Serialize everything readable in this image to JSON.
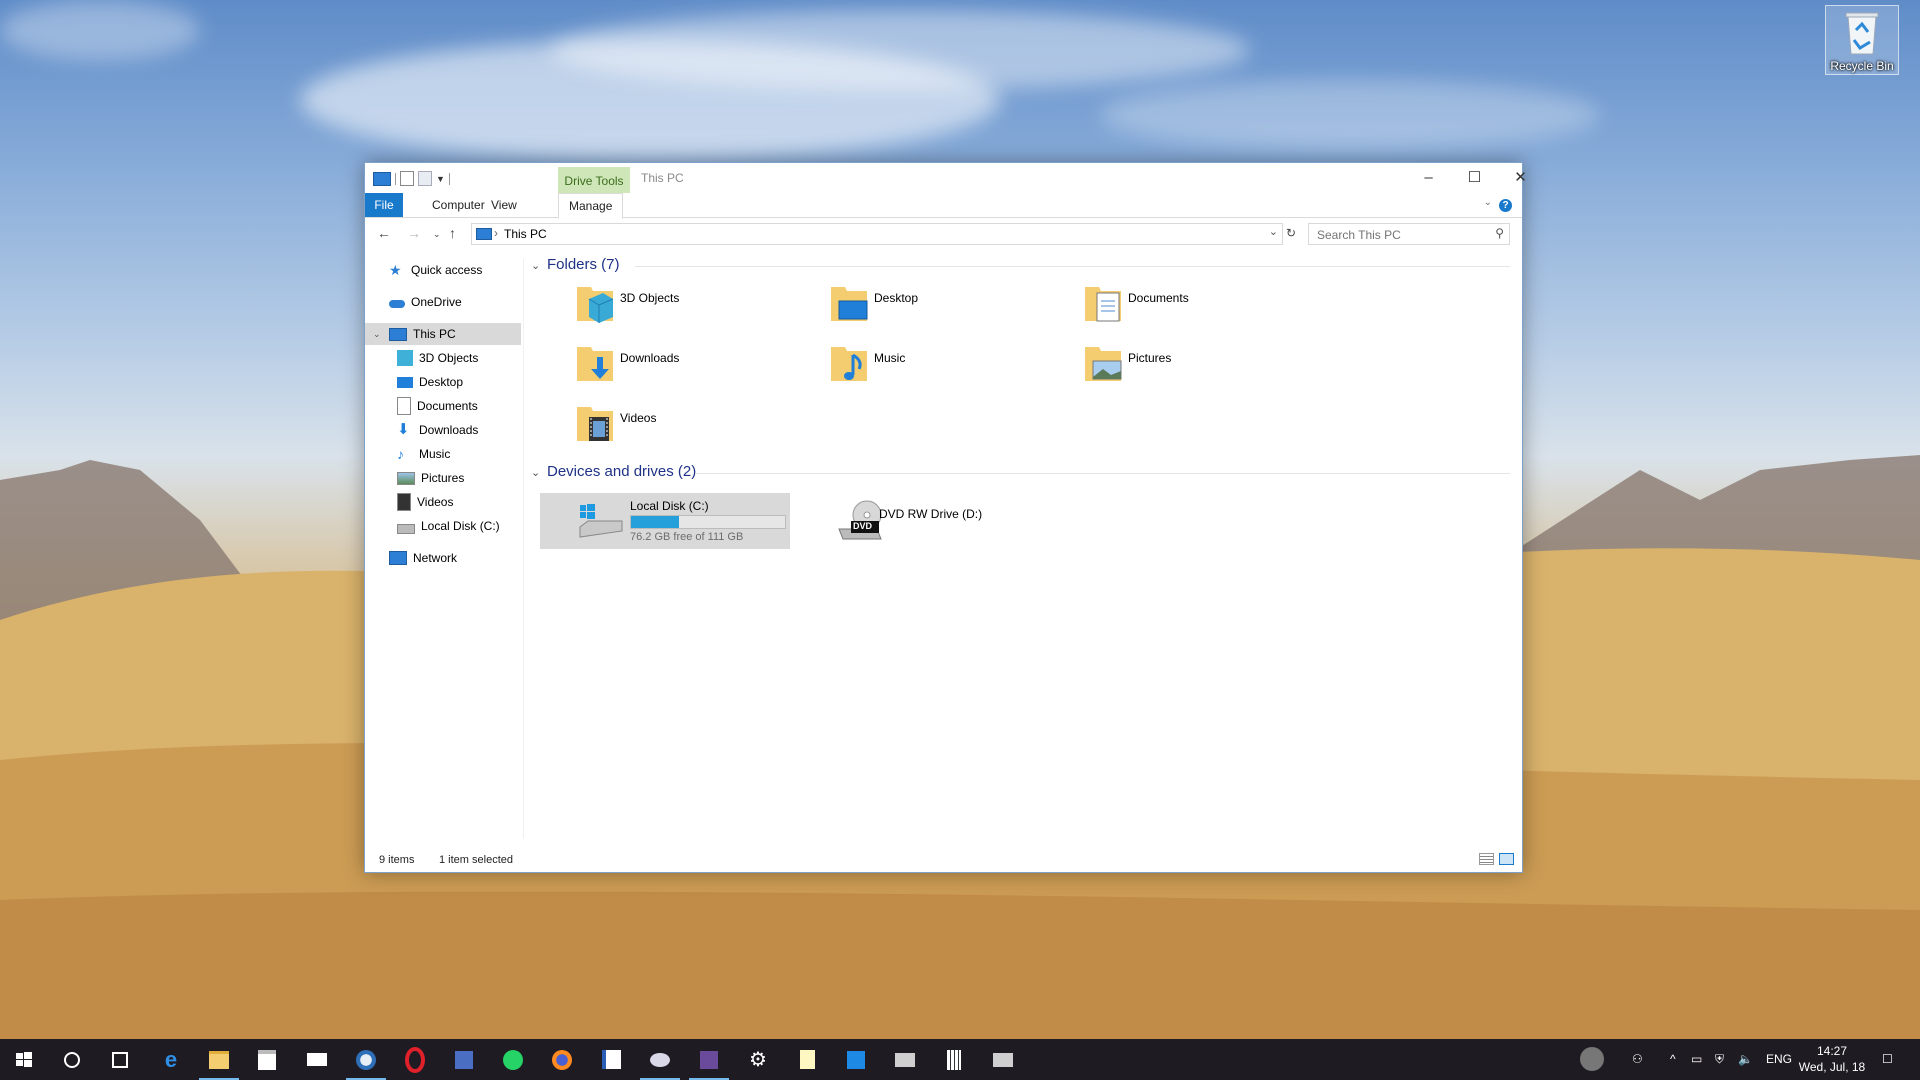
{
  "desktop": {
    "recycle_bin": "Recycle Bin"
  },
  "window": {
    "title": "This PC",
    "context_tab": "Drive Tools",
    "ribbon_tabs": [
      "File",
      "Computer",
      "View",
      "Manage"
    ],
    "help": "?",
    "address": "This PC",
    "search_placeholder": "Search This PC"
  },
  "nav": {
    "items": [
      {
        "label": "Quick access",
        "icon": "star-icon"
      },
      {
        "label": "OneDrive",
        "icon": "cloud-icon"
      },
      {
        "label": "This PC",
        "icon": "computer-icon"
      },
      {
        "label": "3D Objects",
        "icon": "cube-icon"
      },
      {
        "label": "Desktop",
        "icon": "desktop-icon"
      },
      {
        "label": "Documents",
        "icon": "document-icon"
      },
      {
        "label": "Downloads",
        "icon": "download-icon"
      },
      {
        "label": "Music",
        "icon": "music-icon"
      },
      {
        "label": "Pictures",
        "icon": "picture-icon"
      },
      {
        "label": "Videos",
        "icon": "video-icon"
      },
      {
        "label": "Local Disk (C:)",
        "icon": "drive-icon"
      },
      {
        "label": "Network",
        "icon": "network-icon"
      }
    ]
  },
  "content": {
    "folders_header": "Folders (7)",
    "folders": [
      {
        "label": "3D Objects",
        "icon": "cube-icon"
      },
      {
        "label": "Desktop",
        "icon": "desktop-icon"
      },
      {
        "label": "Documents",
        "icon": "document-icon"
      },
      {
        "label": "Downloads",
        "icon": "download-icon"
      },
      {
        "label": "Music",
        "icon": "music-icon"
      },
      {
        "label": "Pictures",
        "icon": "picture-icon"
      },
      {
        "label": "Videos",
        "icon": "video-icon"
      }
    ],
    "drives_header": "Devices and drives (2)",
    "drives": [
      {
        "label": "Local Disk (C:)",
        "free": "76.2 GB free of 111 GB",
        "used_fraction": 0.31
      },
      {
        "label": "DVD RW Drive (D:)",
        "badge": "DVD"
      }
    ]
  },
  "status": {
    "items": "9 items",
    "selected": "1 item selected"
  },
  "taskbar": {
    "apps": [
      "start-icon",
      "search-icon",
      "task-view-icon",
      "edge-icon",
      "file-explorer-icon",
      "store-icon",
      "mail-icon",
      "thunderbird-icon",
      "opera-icon",
      "app-icon",
      "whatsapp-icon",
      "firefox-icon",
      "docs-icon",
      "app-icon",
      "app-icon",
      "settings-icon",
      "notes-icon",
      "app-icon",
      "app-icon",
      "calculator-icon",
      "app-icon"
    ],
    "lang": "ENG",
    "time": "14:27",
    "date": "Wed, Jul, 18"
  },
  "colors": {
    "accent": "#1979ca",
    "selection": "#d9d9d9",
    "drive_bar": "#26a0da",
    "group_header": "#1e3287"
  }
}
